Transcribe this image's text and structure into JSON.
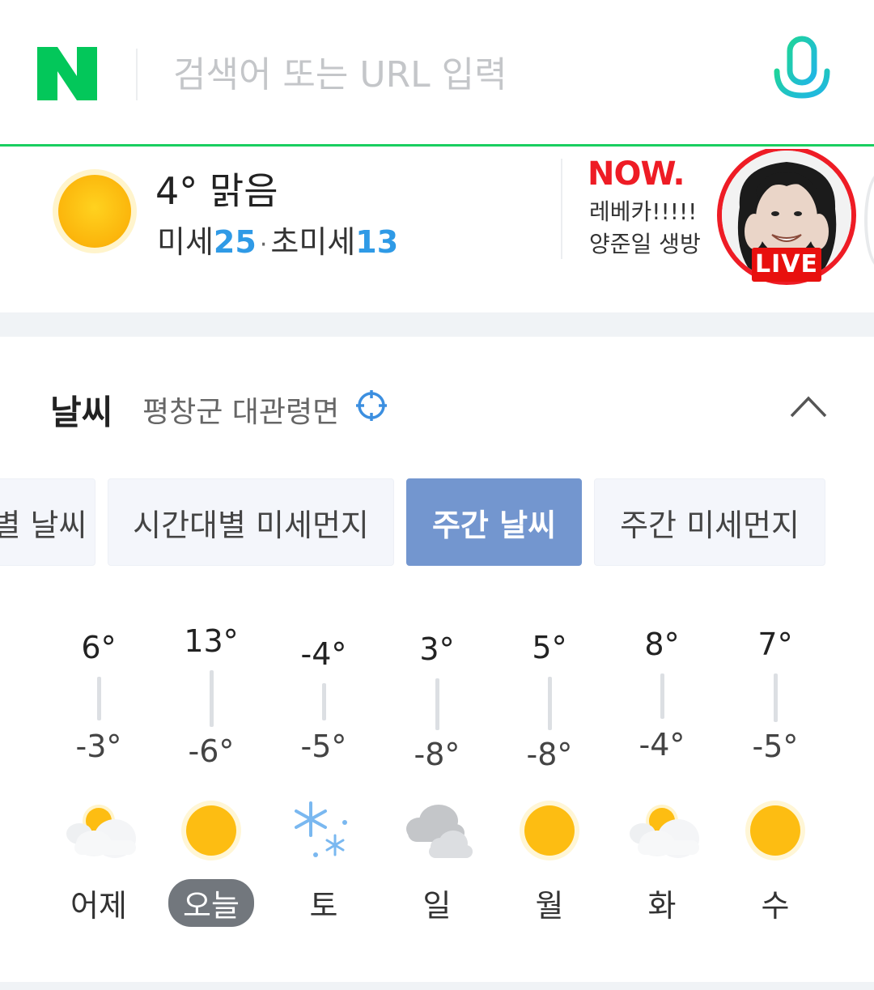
{
  "search": {
    "placeholder": "검색어 또는 URL 입력"
  },
  "summary": {
    "temperature": "4°",
    "condition": "맑음",
    "fine_dust_label": "미세",
    "fine_dust_value": "25",
    "separator": "·",
    "ultrafine_dust_label": "초미세",
    "ultrafine_dust_value": "13"
  },
  "now": {
    "logo_text": "NOW.",
    "line1": "레베카!!!!!",
    "line2": "양준일 생방",
    "live_badge": "LIVE"
  },
  "weather": {
    "title": "날씨",
    "location": "평창군 대관령면",
    "tabs": [
      {
        "label": "별 날씨",
        "active": false
      },
      {
        "label": "시간대별 미세먼지",
        "active": false
      },
      {
        "label": "주간 날씨",
        "active": true
      },
      {
        "label": "주간 미세먼지",
        "active": false
      }
    ],
    "days": [
      {
        "label": "어제",
        "high": "6°",
        "low": "-3°",
        "icon": "partly-cloudy-icon",
        "today": false
      },
      {
        "label": "오늘",
        "high": "13°",
        "low": "-6°",
        "icon": "sun-icon",
        "today": true
      },
      {
        "label": "토",
        "high": "-4°",
        "low": "-5°",
        "icon": "snow-icon",
        "today": false
      },
      {
        "label": "일",
        "high": "3°",
        "low": "-8°",
        "icon": "cloudy-icon",
        "today": false
      },
      {
        "label": "월",
        "high": "5°",
        "low": "-8°",
        "icon": "sun-icon",
        "today": false
      },
      {
        "label": "화",
        "high": "8°",
        "low": "-4°",
        "icon": "partly-cloudy-icon",
        "today": false
      },
      {
        "label": "수",
        "high": "7°",
        "low": "-5°",
        "icon": "sun-icon",
        "today": false
      }
    ]
  },
  "colors": {
    "naver_green": "#03c75a",
    "dust_blue": "#2f9ae6",
    "active_tab": "#7396cf",
    "live_red": "#e8100e"
  }
}
